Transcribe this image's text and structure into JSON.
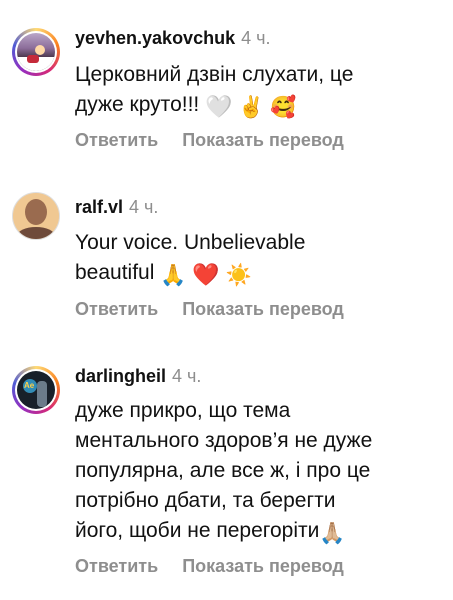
{
  "comments": [
    {
      "username": "yevhen.yakovchuk",
      "time": "4 ч.",
      "text_line1": "Церковний дзвін слухати, це",
      "text_line2": "дуже круто!!! ",
      "emoji": [
        "🤍",
        "✌️",
        "🥰"
      ],
      "reply_label": "Ответить",
      "translate_label": "Показать перевод"
    },
    {
      "username": "ralf.vl",
      "time": "4 ч.",
      "text_line1": "Your voice. Unbelievable",
      "text_line2": "beautiful ",
      "emoji": [
        "🙏",
        "❤️",
        "☀️"
      ],
      "reply_label": "Ответить",
      "translate_label": "Показать перевод"
    },
    {
      "username": "darlingheil",
      "time": "4 ч.",
      "text_lines": [
        "дуже прикро, що тема",
        "ментального здоров’я не дуже",
        "популярна, але все ж, і про це",
        "потрібно дбати, та берегти",
        "його, щоби не перегоріти"
      ],
      "emoji": [
        "🙏🏼"
      ],
      "reply_label": "Ответить",
      "translate_label": "Показать перевод"
    }
  ]
}
